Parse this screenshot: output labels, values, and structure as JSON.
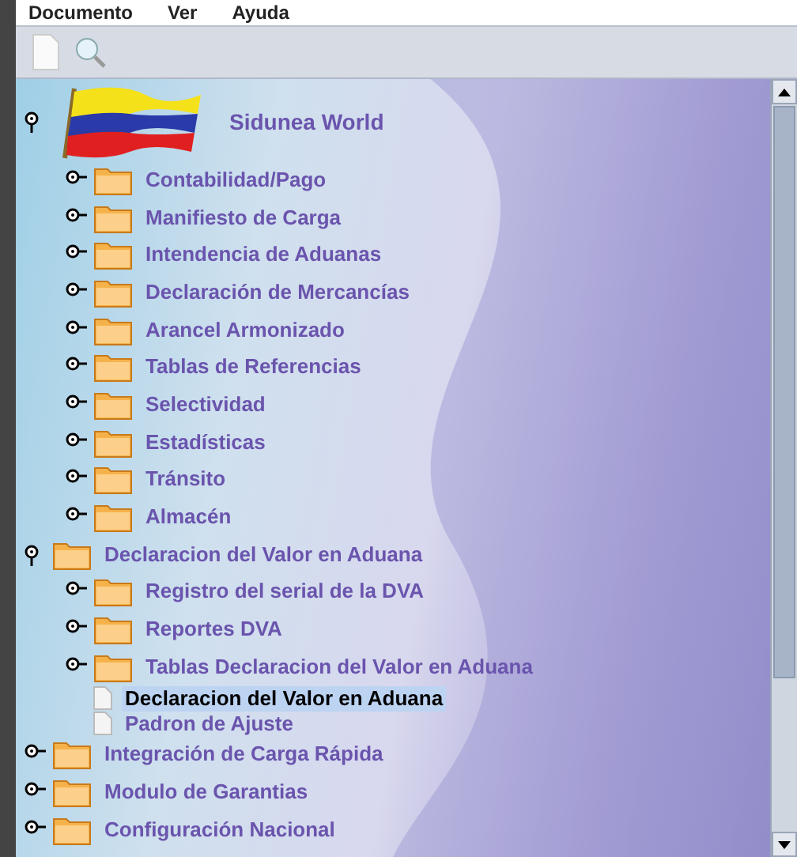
{
  "menu": [
    "Documento",
    "Ver",
    "Ayuda"
  ],
  "tree": [
    {
      "kind": "flag",
      "label": "Sidunea World",
      "expanded": true,
      "children": [
        {
          "kind": "folder",
          "label": "Contabilidad/Pago",
          "expanded": false
        },
        {
          "kind": "folder",
          "label": "Manifiesto de Carga",
          "expanded": false
        },
        {
          "kind": "folder",
          "label": "Intendencia de Aduanas",
          "expanded": false
        },
        {
          "kind": "folder",
          "label": "Declaración de Mercancías",
          "expanded": false
        },
        {
          "kind": "folder",
          "label": "Arancel Armonizado",
          "expanded": false
        },
        {
          "kind": "folder",
          "label": "Tablas de Referencias",
          "expanded": false
        },
        {
          "kind": "folder",
          "label": "Selectividad",
          "expanded": false
        },
        {
          "kind": "folder",
          "label": "Estadísticas",
          "expanded": false
        },
        {
          "kind": "folder",
          "label": "Tránsito",
          "expanded": false
        },
        {
          "kind": "folder",
          "label": "Almacén",
          "expanded": false
        }
      ]
    },
    {
      "kind": "folder",
      "label": "Declaracion del Valor en Aduana",
      "expanded": true,
      "children": [
        {
          "kind": "folder",
          "label": "Registro del serial de la DVA",
          "expanded": false
        },
        {
          "kind": "folder",
          "label": "Reportes DVA",
          "expanded": false
        },
        {
          "kind": "folder",
          "label": "Tablas Declaracion del Valor en Aduana",
          "expanded": false
        },
        {
          "kind": "leaf",
          "label": "Declaracion del Valor en Aduana",
          "selected": true
        },
        {
          "kind": "leaf",
          "label": "Padron de Ajuste",
          "selected": false
        }
      ]
    },
    {
      "kind": "folder",
      "label": "Integración de Carga Rápida",
      "expanded": false
    },
    {
      "kind": "folder",
      "label": "Modulo de Garantias",
      "expanded": false
    },
    {
      "kind": "folder",
      "label": "Configuración Nacional",
      "expanded": false
    }
  ]
}
